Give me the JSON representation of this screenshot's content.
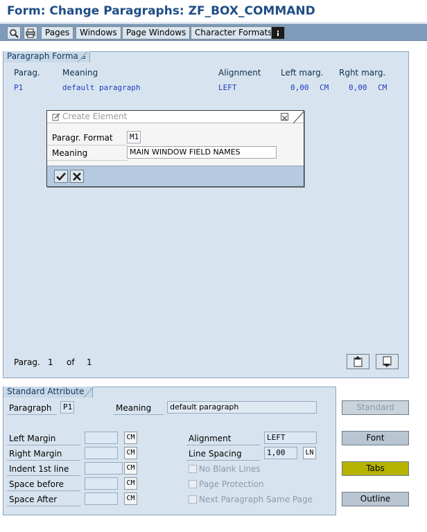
{
  "window": {
    "title": "Form: Change Paragraphs: ZF_BOX_COMMAND"
  },
  "toolbar": {
    "icons": [
      "search-icon",
      "print-preview-icon",
      "info-icon"
    ],
    "buttons": {
      "pages": "Pages",
      "windows": "Windows",
      "page_windows": "Page Windows",
      "character_formats": "Character Formats"
    }
  },
  "paragraph_formats": {
    "tab_label": "Paragraph Formats",
    "columns": {
      "parag": "Parag.",
      "meaning": "Meaning",
      "alignment": "Alignment",
      "left_marg": "Left marg.",
      "rght_marg": "Rght marg."
    },
    "rows": [
      {
        "parag": "P1",
        "meaning": "default paragraph",
        "alignment": "LEFT",
        "left_marg": "0,00",
        "left_unit": "CM",
        "rght_marg": "0,00",
        "rght_unit": "CM"
      }
    ],
    "pager": {
      "label": "Parag.",
      "current": "1",
      "of": "of",
      "total": "1"
    }
  },
  "dialog": {
    "title": "Create Element",
    "paragr_format_label": "Paragr. Format",
    "paragr_format_value": "M1",
    "meaning_label": "Meaning",
    "meaning_value": "MAIN WINDOW FIELD NAMES",
    "confirm_icon": "checkmark-icon",
    "cancel_icon": "cancel-icon"
  },
  "standard_attributes": {
    "tab_label": "Standard Attributes",
    "paragraph_label": "Paragraph",
    "paragraph_value": "P1",
    "meaning_label": "Meaning",
    "meaning_value": "default paragraph",
    "left_margin_label": "Left Margin",
    "right_margin_label": "Right Margin",
    "indent_label": "Indent 1st line",
    "space_before_label": "Space before",
    "space_after_label": "Space After",
    "unit_cm": "CM",
    "alignment_label": "Alignment",
    "alignment_value": "LEFT",
    "line_spacing_label": "Line Spacing",
    "line_spacing_value": "1,00",
    "line_spacing_unit": "LN",
    "no_blank_lines": "No Blank Lines",
    "page_protection": "Page Protection",
    "next_paragraph_same_page": "Next Paragraph Same Page"
  },
  "side_buttons": {
    "standard": "Standard",
    "font": "Font",
    "tabs": "Tabs",
    "outline": "Outline"
  },
  "colors": {
    "title": "#1f4d85",
    "panel": "#d7e4ef",
    "toolbar": "#7e9cba",
    "tabs_highlight": "#b5b300",
    "table_text": "#1f3bbd"
  }
}
